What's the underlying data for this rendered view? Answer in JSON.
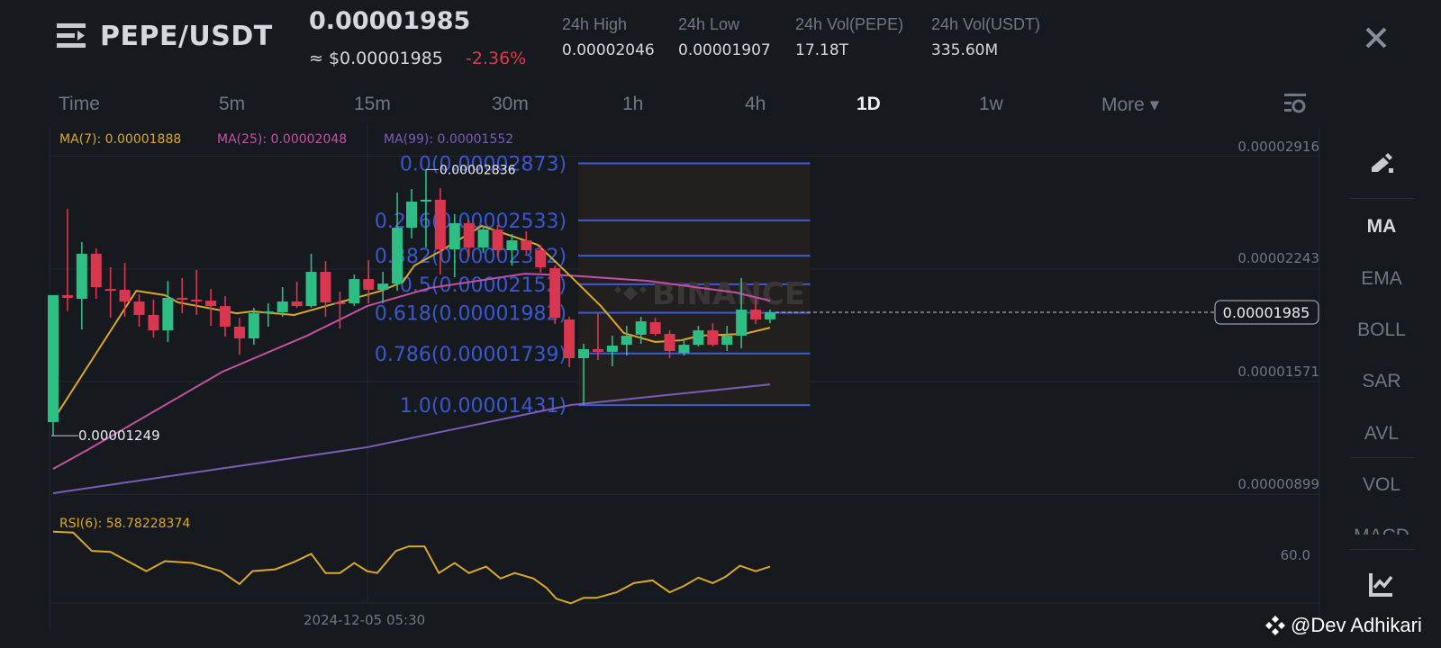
{
  "header": {
    "symbol": "PEPE/USDT",
    "last_price": "0.00001985",
    "usd_price": "≈ $0.00001985",
    "change": "-2.36%",
    "stats": [
      {
        "label": "24h High",
        "value": "0.00002046"
      },
      {
        "label": "24h Low",
        "value": "0.00001907"
      },
      {
        "label": "24h Vol(PEPE)",
        "value": "17.18T"
      },
      {
        "label": "24h Vol(USDT)",
        "value": "335.60M"
      }
    ],
    "close_icon": "close-icon",
    "menu_icon": "menu-icon"
  },
  "tabs": [
    {
      "label": "Time"
    },
    {
      "label": "5m"
    },
    {
      "label": "15m"
    },
    {
      "label": "30m"
    },
    {
      "label": "1h"
    },
    {
      "label": "4h"
    },
    {
      "label": "1D",
      "active": true
    },
    {
      "label": "1w"
    },
    {
      "label": "More ▾"
    }
  ],
  "sidebar": {
    "items": [
      {
        "label": "MA",
        "active": true
      },
      {
        "label": "EMA"
      },
      {
        "label": "BOLL"
      },
      {
        "label": "SAR"
      },
      {
        "label": "AVL"
      },
      {
        "label": "VOL"
      },
      {
        "label": "MACD"
      }
    ]
  },
  "legend": {
    "ma7": "MA(7): 0.00001888",
    "ma25": "MA(25): 0.00002048",
    "ma99": "MA(99): 0.00001552",
    "rsi": "RSI(6): 58.78228374"
  },
  "colors": {
    "bg": "#161a1f",
    "up": "#2ebd85",
    "down": "#d9374f",
    "ma7": "#d9a82a",
    "ma25": "#c64fa6",
    "ma99": "#7d5cb8",
    "fib": "#3d5bd6"
  },
  "watermark": "@Dev Adhikari",
  "brand_watermark": "BINANCE",
  "chart_data": {
    "type": "candlestick",
    "interval": "1D",
    "x_tick_label": "2024-12-05 05:30",
    "y_ticks": [
      "0.00002916",
      "0.00002243",
      "0.00001571",
      "0.00000899"
    ],
    "y_tick_values": [
      2.916e-05,
      2.243e-05,
      1.571e-05,
      8.99e-06
    ],
    "current_price": 1.985e-05,
    "current_price_label": "0.00001985",
    "high_marker": {
      "label": "0.00002836",
      "index": 26,
      "price": 2.836e-05
    },
    "low_marker": {
      "label": "0.00001249",
      "index": 0,
      "price": 1.249e-05
    },
    "candles_ohlc": [
      [
        1.33e-05,
        2.087e-05,
        1.249e-05,
        2.087e-05
      ],
      [
        2.087e-05,
        2.602e-05,
        1.992e-05,
        2.071e-05
      ],
      [
        2.065e-05,
        2.403e-05,
        1.883e-05,
        2.334e-05
      ],
      [
        2.334e-05,
        2.366e-05,
        2.065e-05,
        2.135e-05
      ],
      [
        2.124e-05,
        2.253e-05,
        1.952e-05,
        2.113e-05
      ],
      [
        2.119e-05,
        2.28e-05,
        1.958e-05,
        2.049e-05
      ],
      [
        2.049e-05,
        2.092e-05,
        1.899e-05,
        1.969e-05
      ],
      [
        1.969e-05,
        2.06e-05,
        1.834e-05,
        1.877e-05
      ],
      [
        1.877e-05,
        2.172e-05,
        1.808e-05,
        2.071e-05
      ],
      [
        2.071e-05,
        2.189e-05,
        1.979e-05,
        2.06e-05
      ],
      [
        2.06e-05,
        2.237e-05,
        1.969e-05,
        2.054e-05
      ],
      [
        2.054e-05,
        2.124e-05,
        1.904e-05,
        2.022e-05
      ],
      [
        2.022e-05,
        2.081e-05,
        1.84e-05,
        1.899e-05
      ],
      [
        1.899e-05,
        1.952e-05,
        1.732e-05,
        1.829e-05
      ],
      [
        1.829e-05,
        2.012e-05,
        1.791e-05,
        1.979e-05
      ],
      [
        1.979e-05,
        2.038e-05,
        1.899e-05,
        1.99e-05
      ],
      [
        1.985e-05,
        2.135e-05,
        1.958e-05,
        2.049e-05
      ],
      [
        2.049e-05,
        2.167e-05,
        2.012e-05,
        2.022e-05
      ],
      [
        2.022e-05,
        2.334e-05,
        2.012e-05,
        2.226e-05
      ],
      [
        2.226e-05,
        2.291e-05,
        1.958e-05,
        2.044e-05
      ],
      [
        2.044e-05,
        2.108e-05,
        1.888e-05,
        2.038e-05
      ],
      [
        2.038e-05,
        2.21e-05,
        2.022e-05,
        2.183e-05
      ],
      [
        2.183e-05,
        2.296e-05,
        2.038e-05,
        2.119e-05
      ],
      [
        2.119e-05,
        2.226e-05,
        2.038e-05,
        2.156e-05
      ],
      [
        2.156e-05,
        2.698e-05,
        2.113e-05,
        2.489e-05
      ],
      [
        2.489e-05,
        2.72e-05,
        2.425e-05,
        2.645e-05
      ],
      [
        2.645e-05,
        2.836e-05,
        2.371e-05,
        2.656e-05
      ],
      [
        2.656e-05,
        2.725e-05,
        2.21e-05,
        2.36e-05
      ],
      [
        2.36e-05,
        2.57e-05,
        2.194e-05,
        2.516e-05
      ],
      [
        2.516e-05,
        2.532e-05,
        2.317e-05,
        2.371e-05
      ],
      [
        2.371e-05,
        2.5e-05,
        2.34e-05,
        2.479e-05
      ],
      [
        2.479e-05,
        2.505e-05,
        2.317e-05,
        2.355e-05
      ],
      [
        2.355e-05,
        2.452e-05,
        2.264e-05,
        2.414e-05
      ],
      [
        2.414e-05,
        2.468e-05,
        2.334e-05,
        2.355e-05
      ],
      [
        2.355e-05,
        2.387e-05,
        2.221e-05,
        2.253e-05
      ],
      [
        2.248e-05,
        2.264e-05,
        1.915e-05,
        1.952e-05
      ],
      [
        1.942e-05,
        1.958e-05,
        1.657e-05,
        1.711e-05
      ],
      [
        1.711e-05,
        1.797e-05,
        1.431e-05,
        1.765e-05
      ],
      [
        1.765e-05,
        1.979e-05,
        1.7e-05,
        1.749e-05
      ],
      [
        1.749e-05,
        1.845e-05,
        1.663e-05,
        1.786e-05
      ],
      [
        1.791e-05,
        1.904e-05,
        1.727e-05,
        1.845e-05
      ],
      [
        1.851e-05,
        1.958e-05,
        1.797e-05,
        1.931e-05
      ],
      [
        1.926e-05,
        1.952e-05,
        1.845e-05,
        1.856e-05
      ],
      [
        1.856e-05,
        1.877e-05,
        1.711e-05,
        1.754e-05
      ],
      [
        1.743e-05,
        1.824e-05,
        1.727e-05,
        1.791e-05
      ],
      [
        1.791e-05,
        1.904e-05,
        1.781e-05,
        1.877e-05
      ],
      [
        1.877e-05,
        1.92e-05,
        1.781e-05,
        1.791e-05
      ],
      [
        1.791e-05,
        1.904e-05,
        1.754e-05,
        1.845e-05
      ],
      [
        1.845e-05,
        2.189e-05,
        1.77e-05,
        2.001e-05
      ],
      [
        2.001e-05,
        2.076e-05,
        1.915e-05,
        1.942e-05
      ],
      [
        1.942e-05,
        2.001e-05,
        1.92e-05,
        1.985e-05
      ]
    ],
    "ma7": [
      [
        0,
        1.341e-05
      ],
      [
        5.8,
        2.113e-05
      ],
      [
        7.8,
        2.087e-05
      ],
      [
        8.7,
        2.044e-05
      ],
      [
        12.8,
        1.979e-05
      ],
      [
        13.9,
        1.99e-05
      ],
      [
        16.8,
        1.969e-05
      ],
      [
        19.7,
        2.038e-05
      ],
      [
        22.9,
        2.113e-05
      ],
      [
        24.4,
        2.167e-05
      ],
      [
        25.2,
        2.264e-05
      ],
      [
        26.9,
        2.344e-05
      ],
      [
        29.9,
        2.5e-05
      ],
      [
        33.8,
        2.387e-05
      ],
      [
        36.1,
        2.199e-05
      ],
      [
        38.2,
        2.022e-05
      ],
      [
        39.8,
        1.861e-05
      ],
      [
        42,
        1.808e-05
      ],
      [
        43.8,
        1.818e-05
      ],
      [
        45.1,
        1.845e-05
      ],
      [
        48.2,
        1.856e-05
      ],
      [
        50,
        1.893e-05
      ]
    ],
    "ma25": [
      [
        0,
        1.051e-05
      ],
      [
        2.4,
        1.164e-05
      ],
      [
        11.8,
        1.63e-05
      ],
      [
        17.7,
        1.845e-05
      ],
      [
        21.9,
        2.022e-05
      ],
      [
        26.3,
        2.13e-05
      ],
      [
        32.9,
        2.215e-05
      ],
      [
        35.9,
        2.205e-05
      ],
      [
        41.5,
        2.172e-05
      ],
      [
        47.6,
        2.103e-05
      ],
      [
        50,
        2.054e-05
      ]
    ],
    "ma99": [
      [
        0,
        9.06e-06
      ],
      [
        21.9,
        1.18e-05
      ],
      [
        36.1,
        1.432e-05
      ],
      [
        50,
        1.555e-05
      ]
    ],
    "fibonacci": {
      "start_index": 37,
      "end_index": 52.8,
      "levels": [
        {
          "ratio": 0.0,
          "price": 2.873e-05,
          "label": "0.0(0.00002873)"
        },
        {
          "ratio": 0.236,
          "price": 2.533e-05,
          "label": "0.236(0.00002533)"
        },
        {
          "ratio": 0.382,
          "price": 2.322e-05,
          "label": "0.382(0.00002322)"
        },
        {
          "ratio": 0.5,
          "price": 2.152e-05,
          "label": "0.5(0.00002152)"
        },
        {
          "ratio": 0.618,
          "price": 1.982e-05,
          "label": "0.618(0.00001982)"
        },
        {
          "ratio": 0.786,
          "price": 1.739e-05,
          "label": "0.786(0.00001739)"
        },
        {
          "ratio": 1.0,
          "price": 1.431e-05,
          "label": "1.0(0.00001431)"
        }
      ]
    },
    "rsi": {
      "tick_label": "60.0",
      "tick_value": 60,
      "points": [
        [
          0,
          62.35
        ],
        [
          1.4,
          62.26
        ],
        [
          2.7,
          60.38
        ],
        [
          4,
          60.28
        ],
        [
          6.5,
          58.31
        ],
        [
          7.8,
          59.34
        ],
        [
          9.7,
          59.15
        ],
        [
          11.7,
          58.31
        ],
        [
          13,
          56.99
        ],
        [
          13.9,
          58.31
        ],
        [
          15.5,
          58.5
        ],
        [
          16.8,
          59.25
        ],
        [
          18,
          60.09
        ],
        [
          19,
          58.12
        ],
        [
          20,
          58.12
        ],
        [
          21,
          59.15
        ],
        [
          21.9,
          58.31
        ],
        [
          22.6,
          58.12
        ],
        [
          23.9,
          60.38
        ],
        [
          24.8,
          60.85
        ],
        [
          25.9,
          60.85
        ],
        [
          26.9,
          58.12
        ],
        [
          28,
          59.15
        ],
        [
          29,
          58.12
        ],
        [
          30.2,
          58.78
        ],
        [
          31.2,
          57.56
        ],
        [
          32.2,
          58.12
        ],
        [
          33.5,
          57.56
        ],
        [
          34.4,
          56.62
        ],
        [
          35.1,
          55.49
        ],
        [
          36.1,
          55.02
        ],
        [
          37,
          55.58
        ],
        [
          37.9,
          55.58
        ],
        [
          39.3,
          56.15
        ],
        [
          40.5,
          57.09
        ],
        [
          41.8,
          57.37
        ],
        [
          43,
          56.15
        ],
        [
          44,
          56.8
        ],
        [
          45,
          57.65
        ],
        [
          46,
          57.09
        ],
        [
          46.9,
          57.74
        ],
        [
          47.9,
          58.87
        ],
        [
          49,
          58.31
        ],
        [
          50,
          58.78228374
        ]
      ]
    }
  }
}
